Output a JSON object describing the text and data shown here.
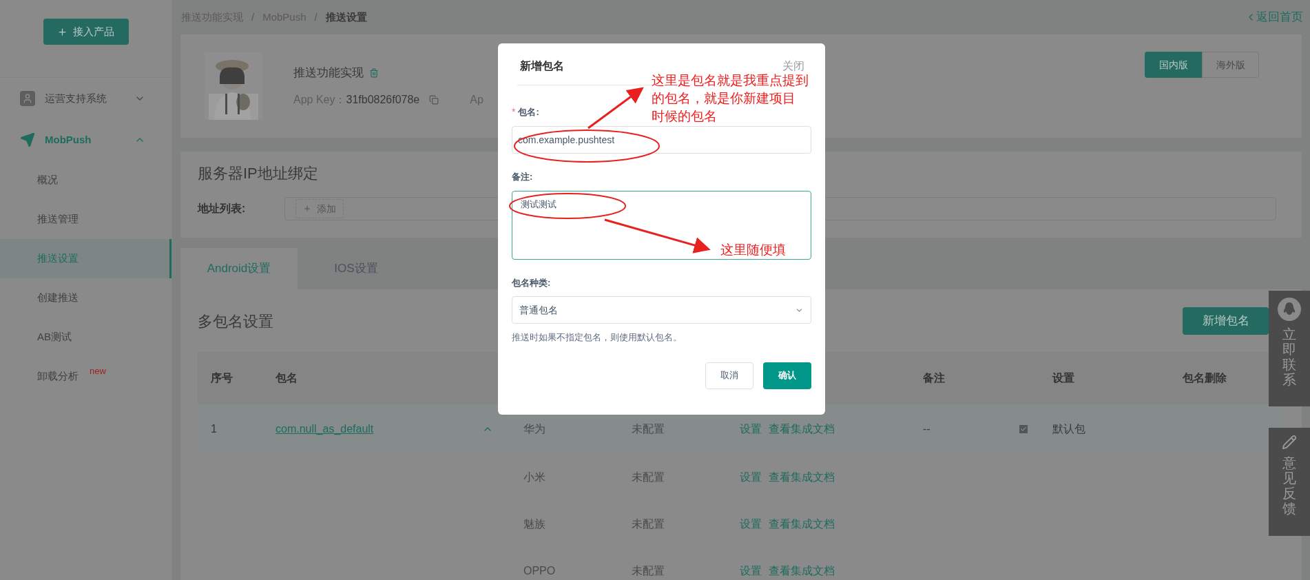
{
  "breadcrumb": [
    {
      "label": "推送功能实现",
      "current": false
    },
    {
      "separator": "/",
      "label": "MobPush",
      "current": false
    },
    {
      "separator": "/",
      "label": "推送设置",
      "current": true
    }
  ],
  "back_link": "返回首页",
  "sidebar": {
    "add_button": "接入产品",
    "groups": [
      {
        "label": "运营支持系统",
        "expanded": false
      },
      {
        "label": "MobPush",
        "expanded": true,
        "children": [
          {
            "label": "概况",
            "selected": false
          },
          {
            "label": "推送管理",
            "selected": false
          },
          {
            "label": "推送设置",
            "selected": true
          },
          {
            "label": "创建推送",
            "selected": false
          },
          {
            "label": "AB测试",
            "selected": false
          },
          {
            "label": "卸载分析",
            "selected": false,
            "badge": "new"
          }
        ]
      }
    ]
  },
  "app": {
    "name": "推送功能实现",
    "key_label": "App Key：",
    "key_value": "31fb0826f078e",
    "cut_label": "Ap"
  },
  "region_toggle": [
    {
      "label": "国内版",
      "selected": true
    },
    {
      "label": "海外版",
      "selected": false
    }
  ],
  "server_ip": {
    "title": "服务器IP地址绑定",
    "list_label": "地址列表:",
    "add_button": "添加"
  },
  "tabs": [
    {
      "label": "Android设置",
      "selected": true
    },
    {
      "label": "IOS设置",
      "selected": false
    }
  ],
  "packages": {
    "title": "多包名设置",
    "add_button": "新增包名",
    "columns": [
      "序号",
      "包名",
      "备注",
      "设置",
      "包名删除"
    ],
    "rows": [
      {
        "index": "1",
        "package": "com.null_as_default",
        "expanded": true,
        "note": "--",
        "is_default": true,
        "setting": "默认包",
        "vendors": [
          {
            "name": "华为",
            "status": "未配置",
            "links": [
              "设置",
              "查看集成文档"
            ]
          },
          {
            "name": "小米",
            "status": "未配置",
            "links": [
              "设置",
              "查看集成文档"
            ]
          },
          {
            "name": "魅族",
            "status": "未配置",
            "links": [
              "设置",
              "查看集成文档"
            ]
          },
          {
            "name": "OPPO",
            "status": "未配置",
            "links": [
              "设置",
              "查看集成文档"
            ]
          }
        ]
      }
    ]
  },
  "dialog": {
    "title": "新增包名",
    "close": "关闭",
    "fields": [
      {
        "kind": "input",
        "required_mark": "*",
        "label": "包名:",
        "value": "com.example.pushtest",
        "focused": false
      },
      {
        "kind": "textarea",
        "label": "备注:",
        "value": "测试测试",
        "focused": true
      },
      {
        "kind": "select",
        "label": "包名种类:",
        "value": "普通包名",
        "focused": false
      }
    ],
    "hint": "推送时如果不指定包名，则使用默认包名。",
    "buttons": [
      {
        "label": "取消",
        "primary": false
      },
      {
        "label": "确认",
        "primary": true
      }
    ]
  },
  "annotations": [
    {
      "lines": [
        "这里是包名就是我重点提到",
        "的包名，就是你新建项目",
        "时候的包名"
      ]
    },
    {
      "lines": [
        "这里随便填"
      ]
    }
  ],
  "floating": [
    {
      "label": "立即联系"
    },
    {
      "label": "意见反馈"
    }
  ]
}
